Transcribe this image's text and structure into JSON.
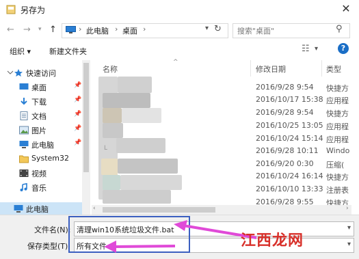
{
  "window": {
    "title": "另存为"
  },
  "address": {
    "crumbs": [
      "此电脑",
      "桌面"
    ],
    "search_placeholder": "搜索\"桌面\""
  },
  "toolbar": {
    "organize": "组织 ▾",
    "new_folder": "新建文件夹"
  },
  "sidebar": {
    "items": [
      {
        "label": "快速访问",
        "icon": "star-icon"
      },
      {
        "label": "桌面",
        "icon": "desktop-icon",
        "pinned": true
      },
      {
        "label": "下载",
        "icon": "download-icon",
        "pinned": true
      },
      {
        "label": "文档",
        "icon": "document-icon",
        "pinned": true
      },
      {
        "label": "图片",
        "icon": "picture-icon",
        "pinned": true
      },
      {
        "label": "此电脑",
        "icon": "computer-icon",
        "pinned": true
      },
      {
        "label": "System32",
        "icon": "folder-icon"
      },
      {
        "label": "视频",
        "icon": "video-icon"
      },
      {
        "label": "音乐",
        "icon": "music-icon"
      },
      {
        "label": "此电脑",
        "icon": "computer-icon",
        "selected": true
      }
    ]
  },
  "columns": {
    "name": "名称",
    "date": "修改日期",
    "type": "类型"
  },
  "files": [
    {
      "date": "2016/9/28 9:54",
      "type": "快捷方"
    },
    {
      "date": "2016/10/17 15:38",
      "type": "应用程"
    },
    {
      "date": "2016/9/28 9:54",
      "type": "快捷方"
    },
    {
      "date": "2016/10/25 13:05",
      "type": "应用程"
    },
    {
      "date": "2016/10/24 15:14",
      "type": "应用程"
    },
    {
      "date": "2016/9/28 10:11",
      "type": "Windo"
    },
    {
      "date": "2016/9/20 0:30",
      "type": "压缩("
    },
    {
      "date": "2016/10/24 16:14",
      "type": "快捷方"
    },
    {
      "date": "2016/10/10 13:33",
      "type": "注册表"
    },
    {
      "date": "2016/9/28 9:55",
      "type": "快捷方"
    }
  ],
  "save": {
    "filename_label": "文件名(N):",
    "filename_value": "清理win10系统垃圾文件.bat",
    "filetype_label": "保存类型(T):",
    "filetype_value": "所有文件"
  },
  "watermark": "江西龙网",
  "colors": {
    "accent": "#1a6ec6",
    "highlight_box": "#3b5fc0",
    "arrow": "#e04ad8",
    "watermark": "#d8302a"
  }
}
